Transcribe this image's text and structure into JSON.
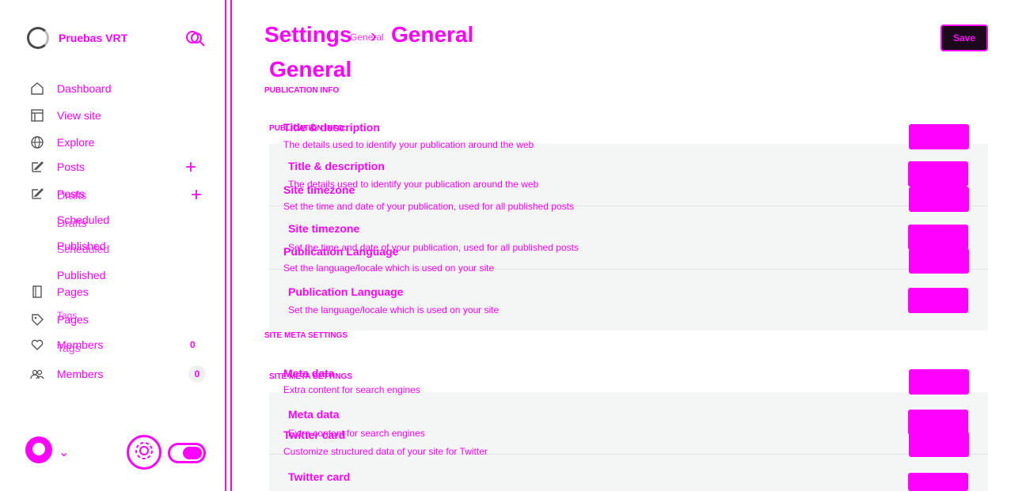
{
  "colors": {
    "accent": "#ff00ff",
    "panel": "#f4f6f5",
    "save_bg": "#1a0a1a"
  },
  "brand": {
    "name": "Pruebas VRT"
  },
  "nav": {
    "dashboard": "Dashboard",
    "view_site": "View site",
    "explore": "Explore",
    "posts": "Posts",
    "drafts": "Drafts",
    "scheduled": "Scheduled",
    "published": "Published",
    "pages": "Pages",
    "tags": "Tags",
    "members": "Members",
    "posts_dup": "Posts",
    "drafts_dup": "Drafts",
    "scheduled_dup": "Scheduled",
    "published_dup": "Published",
    "pages_dup": "Pages",
    "tags_dup": "Tags",
    "members_dup": "Members",
    "members_count": "0",
    "members_count_dup": "0"
  },
  "header": {
    "crumb_settings": "Settings",
    "crumb_general_small": "General",
    "crumb_sep": "›",
    "crumb_general": "General",
    "page_title": "General",
    "save_label": "Save"
  },
  "sections": {
    "publication_info": "PUBLICATION INFO",
    "publication_info_dup": "PUBLICATION INFO",
    "site_meta": "SITE META SETTINGS",
    "site_meta_dup": "SITE META SETTINGS"
  },
  "rows": {
    "title_desc": {
      "title": "Title & description",
      "desc": "The details used to identify your publication around the web"
    },
    "timezone": {
      "title": "Site timezone",
      "desc": "Set the time and date of your publication, used for all published posts"
    },
    "language": {
      "title": "Publication Language",
      "desc": "Set the language/locale which is used on your site"
    },
    "meta": {
      "title": "Meta data",
      "desc": "Extra content for search engines"
    },
    "twitter": {
      "title": "Twitter card",
      "desc": "Customize structured data of your site for Twitter"
    }
  }
}
